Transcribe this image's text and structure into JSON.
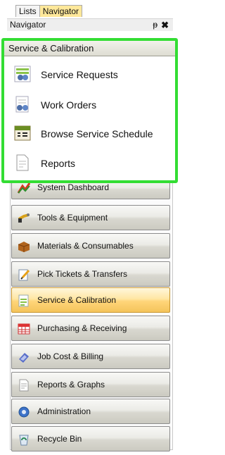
{
  "tabs": [
    {
      "label": "Lists",
      "active": false
    },
    {
      "label": "Navigator",
      "active": true
    }
  ],
  "navigator": {
    "title": "Navigator",
    "pin_glyph": "ᵽ",
    "close_glyph": "✖"
  },
  "flyout": {
    "title": "Service & Calibration",
    "highlight_color": "#33dd33",
    "items": [
      {
        "label": "Service Requests",
        "icon": "service-requests-icon"
      },
      {
        "label": "Work Orders",
        "icon": "work-orders-icon"
      },
      {
        "label": "Browse Service Schedule",
        "icon": "calendar-icon"
      },
      {
        "label": "Reports",
        "icon": "report-document-icon"
      }
    ]
  },
  "categories": [
    {
      "label": "System Dashboard",
      "icon": "dashboard-icon",
      "selected": false
    },
    {
      "label": "Tools & Equipment",
      "icon": "tools-icon",
      "selected": false
    },
    {
      "label": "Materials & Consumables",
      "icon": "materials-box-icon",
      "selected": false
    },
    {
      "label": "Pick Tickets & Transfers",
      "icon": "pick-ticket-icon",
      "selected": false
    },
    {
      "label": "Service & Calibration",
      "icon": "service-calibration-icon",
      "selected": true
    },
    {
      "label": "Purchasing & Receiving",
      "icon": "purchasing-icon",
      "selected": false
    },
    {
      "label": "Job Cost & Billing",
      "icon": "billing-icon",
      "selected": false
    },
    {
      "label": "Reports & Graphs",
      "icon": "reports-graphs-icon",
      "selected": false
    },
    {
      "label": "Administration",
      "icon": "administration-icon",
      "selected": false
    },
    {
      "label": "Recycle Bin",
      "icon": "recycle-bin-icon",
      "selected": false
    }
  ],
  "colors": {
    "selected_category": "#ffd57a",
    "active_tab": "#ffe89a"
  }
}
